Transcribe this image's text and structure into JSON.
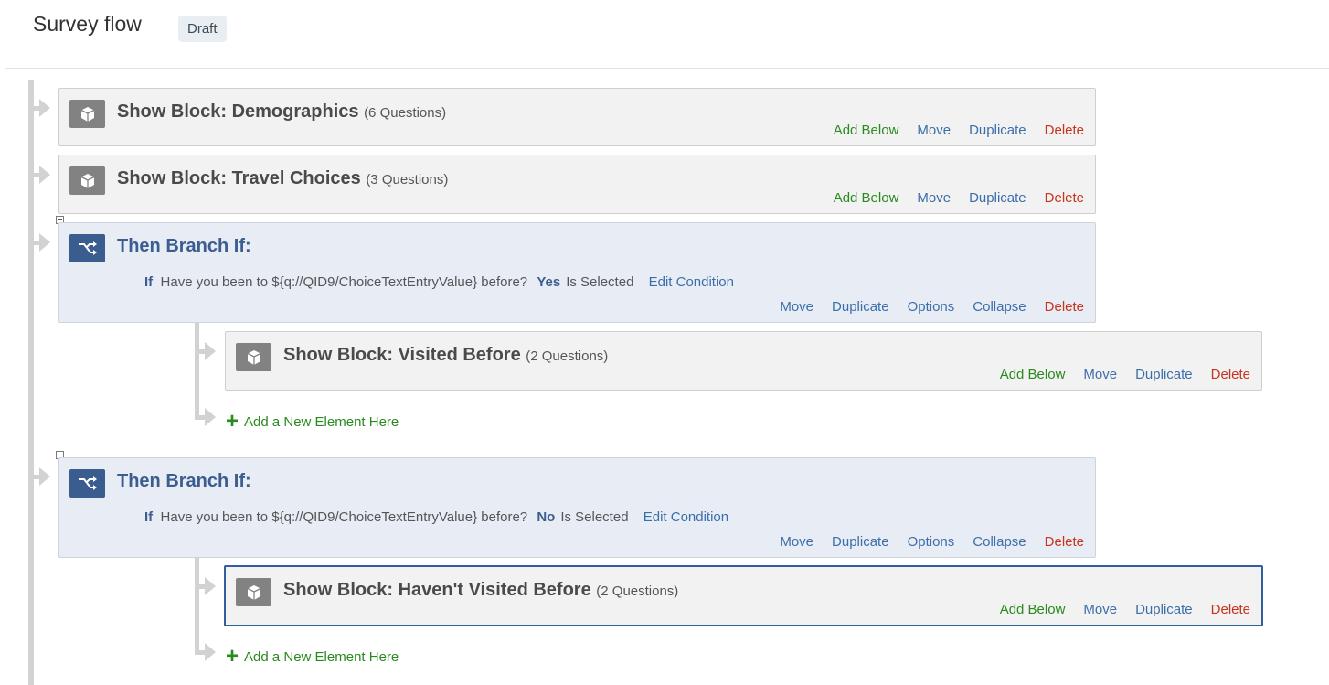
{
  "header": {
    "title": "Survey flow",
    "status_badge": "Draft"
  },
  "colors": {
    "add": "#2a8a1f",
    "link": "#3c6eaa",
    "delete": "#c8331e",
    "branch_bg": "#e8edf5",
    "block_bg": "#f2f2f2"
  },
  "flow": {
    "demographics": {
      "title": "Show Block: Demographics",
      "count": "(6 Questions)",
      "icon": "cube-icon",
      "actions": {
        "add_below": "Add Below",
        "move": "Move",
        "duplicate": "Duplicate",
        "delete": "Delete"
      }
    },
    "travel": {
      "title": "Show Block: Travel Choices",
      "count": "(3 Questions)",
      "icon": "cube-icon",
      "actions": {
        "add_below": "Add Below",
        "move": "Move",
        "duplicate": "Duplicate",
        "delete": "Delete"
      }
    },
    "branch1": {
      "title": "Then Branch If:",
      "icon": "branch-icon",
      "condition": {
        "if": "If",
        "text": "Have you been to ${q://QID9/ChoiceTextEntryValue} before?",
        "value": "Yes",
        "operator": "Is Selected",
        "edit": "Edit Condition"
      },
      "actions": {
        "move": "Move",
        "duplicate": "Duplicate",
        "options": "Options",
        "collapse": "Collapse",
        "delete": "Delete"
      },
      "child": {
        "title": "Show Block: Visited Before",
        "count": "(2 Questions)",
        "icon": "cube-icon",
        "actions": {
          "add_below": "Add Below",
          "move": "Move",
          "duplicate": "Duplicate",
          "delete": "Delete"
        }
      },
      "add_new": "Add a New Element Here"
    },
    "branch2": {
      "title": "Then Branch If:",
      "icon": "branch-icon",
      "condition": {
        "if": "If",
        "text": "Have you been to ${q://QID9/ChoiceTextEntryValue} before?",
        "value": "No",
        "operator": "Is Selected",
        "edit": "Edit Condition"
      },
      "actions": {
        "move": "Move",
        "duplicate": "Duplicate",
        "options": "Options",
        "collapse": "Collapse",
        "delete": "Delete"
      },
      "child": {
        "title": "Show Block: Haven't Visited Before",
        "count": "(2 Questions)",
        "icon": "cube-icon",
        "actions": {
          "add_below": "Add Below",
          "move": "Move",
          "duplicate": "Duplicate",
          "delete": "Delete"
        }
      },
      "add_new": "Add a New Element Here"
    }
  }
}
